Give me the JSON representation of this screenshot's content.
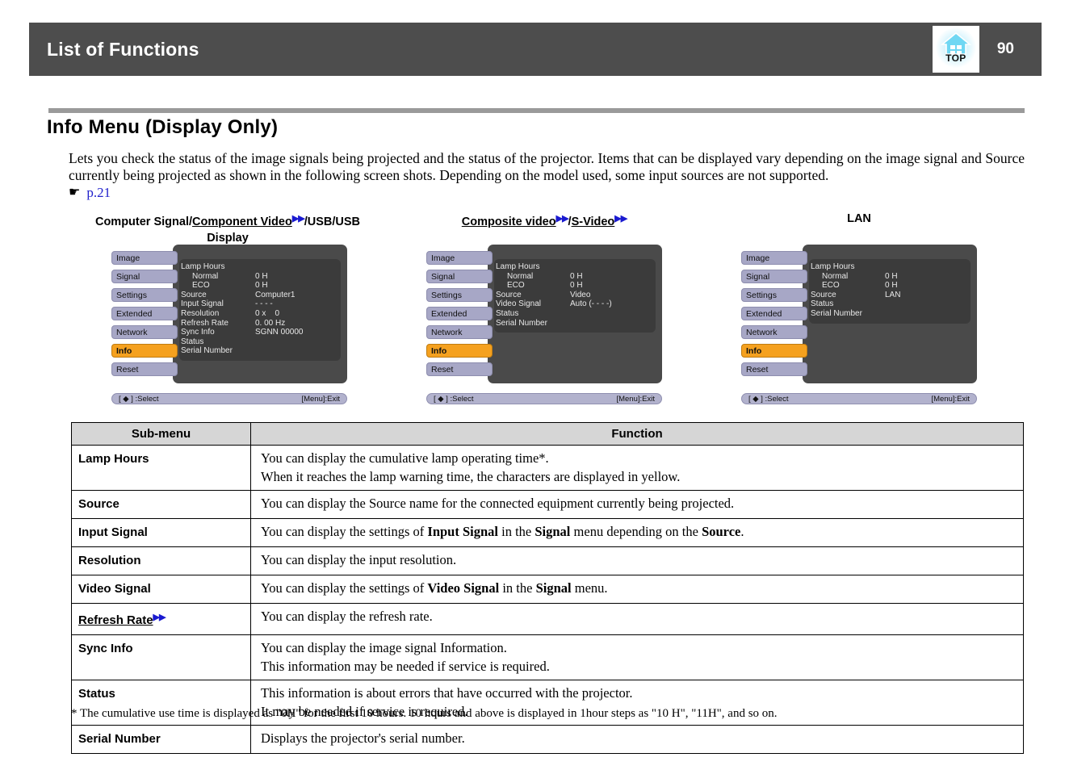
{
  "header": {
    "title": "List of Functions",
    "page_number": "90",
    "top_icon_label": "TOP",
    "icon_name": "home-top-icon",
    "bar_color": "#4d4d4d"
  },
  "section": {
    "title": "Info Menu (Display Only)",
    "intro": "Lets you check the status of the image signals being projected and the status of the projector. Items that can be displayed vary depending on the image signal and Source currently being projected as shown in the following screen shots. Depending on the model used, some input sources are not supported.",
    "reference_link": "p.21",
    "reference_marker": "☛",
    "link_color": "#2222cc"
  },
  "screenshots": {
    "captions": {
      "one_pre": "Computer Signal/",
      "one_underlined": "Component Video",
      "one_post": "/USB/USB",
      "one_second_line": "Display",
      "two_underlined_a": "Composite video",
      "two_mid": "/",
      "two_underlined_b": "S-Video",
      "three": "LAN"
    },
    "nav_items": [
      "Image",
      "Signal",
      "Settings",
      "Extended",
      "Network",
      "Info",
      "Reset"
    ],
    "active_nav": "Info",
    "footer_select": "[ ◆ ] :Select",
    "footer_exit": "[Menu]:Exit",
    "highlight_color": "#f5a11f",
    "nav_color": "#a7a7c6",
    "panel_color": "#4a4a4a",
    "shots": [
      {
        "id": "computer-signal",
        "rows": [
          {
            "label": "Lamp Hours",
            "value": "",
            "indent": false
          },
          {
            "label": "Normal",
            "value": "0 H",
            "indent": true
          },
          {
            "label": "ECO",
            "value": "0 H",
            "indent": true
          },
          {
            "label": "Source",
            "value": "Computer1",
            "indent": false
          },
          {
            "label": "Input Signal",
            "value": "- - - -",
            "indent": false
          },
          {
            "label": "Resolution",
            "value": "0 x    0",
            "indent": false
          },
          {
            "label": "Refresh Rate",
            "value": "0. 00 Hz",
            "indent": false
          },
          {
            "label": "Sync Info",
            "value": "SGNN 00000",
            "indent": false
          },
          {
            "label": "Status",
            "value": "",
            "indent": false
          },
          {
            "label": "Serial Number",
            "value": "",
            "indent": false
          }
        ]
      },
      {
        "id": "composite-video",
        "rows": [
          {
            "label": "Lamp Hours",
            "value": "",
            "indent": false
          },
          {
            "label": "Normal",
            "value": "0 H",
            "indent": true
          },
          {
            "label": "ECO",
            "value": "0 H",
            "indent": true
          },
          {
            "label": "Source",
            "value": "Video",
            "indent": false
          },
          {
            "label": "Video Signal",
            "value": "Auto (- - - -)",
            "indent": false
          },
          {
            "label": "Status",
            "value": "",
            "indent": false
          },
          {
            "label": "Serial Number",
            "value": "",
            "indent": false
          }
        ]
      },
      {
        "id": "lan",
        "rows": [
          {
            "label": "Lamp Hours",
            "value": "",
            "indent": false
          },
          {
            "label": "Normal",
            "value": "0 H",
            "indent": true
          },
          {
            "label": "ECO",
            "value": "0 H",
            "indent": true
          },
          {
            "label": "Source",
            "value": "LAN",
            "indent": false
          },
          {
            "label": "Status",
            "value": "",
            "indent": false
          },
          {
            "label": "Serial Number",
            "value": "",
            "indent": false
          }
        ]
      }
    ]
  },
  "table": {
    "headers": {
      "sub_menu": "Sub-menu",
      "function": "Function"
    },
    "rows": [
      {
        "sub_menu": "Lamp Hours",
        "underlined": false,
        "lines": [
          [
            {
              "t": "You can display the cumulative lamp operating time*.",
              "b": false
            }
          ],
          [
            {
              "t": "When it reaches the lamp warning time, the characters are displayed in yellow.",
              "b": false
            }
          ]
        ]
      },
      {
        "sub_menu": "Source",
        "underlined": false,
        "lines": [
          [
            {
              "t": "You can display the Source name for the connected equipment currently being projected.",
              "b": false
            }
          ]
        ]
      },
      {
        "sub_menu": "Input Signal",
        "underlined": false,
        "lines": [
          [
            {
              "t": "You can display the settings of ",
              "b": false
            },
            {
              "t": "Input Signal",
              "b": true
            },
            {
              "t": " in the ",
              "b": false
            },
            {
              "t": "Signal",
              "b": true
            },
            {
              "t": " menu depending on the ",
              "b": false
            },
            {
              "t": "Source",
              "b": true
            },
            {
              "t": ".",
              "b": false
            }
          ]
        ]
      },
      {
        "sub_menu": "Resolution",
        "underlined": false,
        "lines": [
          [
            {
              "t": "You can display the input resolution.",
              "b": false
            }
          ]
        ]
      },
      {
        "sub_menu": "Video Signal",
        "underlined": false,
        "lines": [
          [
            {
              "t": "You can display the settings of ",
              "b": false
            },
            {
              "t": "Video Signal",
              "b": true
            },
            {
              "t": " in the ",
              "b": false
            },
            {
              "t": "Signal",
              "b": true
            },
            {
              "t": " menu.",
              "b": false
            }
          ]
        ]
      },
      {
        "sub_menu": "Refresh Rate",
        "underlined": true,
        "lines": [
          [
            {
              "t": "You can display the refresh rate.",
              "b": false
            }
          ]
        ]
      },
      {
        "sub_menu": "Sync Info",
        "underlined": false,
        "lines": [
          [
            {
              "t": "You can display the image signal Information.",
              "b": false
            }
          ],
          [
            {
              "t": "This information may be needed if service is required.",
              "b": false
            }
          ]
        ]
      },
      {
        "sub_menu": "Status",
        "underlined": false,
        "lines": [
          [
            {
              "t": "This information is about errors that have occurred with the projector.",
              "b": false
            }
          ],
          [
            {
              "t": "It may be needed if service is required.",
              "b": false
            }
          ]
        ]
      },
      {
        "sub_menu": "Serial Number",
        "underlined": false,
        "lines": [
          [
            {
              "t": "Displays the projector's serial number.",
              "b": false
            }
          ]
        ]
      }
    ]
  },
  "footnote": "* The cumulative use time is displayed as \"0H\" for the first 10 hours. 10 hours and above is displayed in 1hour steps as \"10 H\", \"11H\", and so on."
}
